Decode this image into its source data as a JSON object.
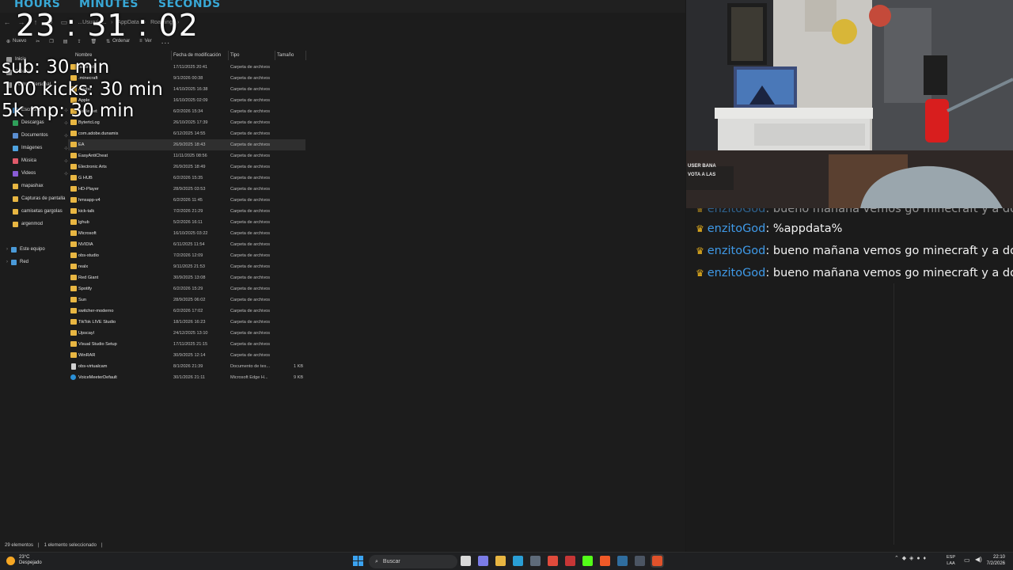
{
  "stream_timer": {
    "labels": [
      "HOURS",
      "MINUTES",
      "SECONDS"
    ],
    "value": "23 :  31 :  02"
  },
  "goals": [
    "sub: 30 min",
    "100 kicks: 30 min",
    "5k mp: 30 min"
  ],
  "explorer": {
    "breadcrumbs": [
      "...Usuario...",
      "AppData",
      "Roaming"
    ],
    "toolbar": {
      "new_label": "Nuevo",
      "sort_label": "Ordenar",
      "view_label": "Ver",
      "more_label": "..."
    },
    "nav": {
      "top": [
        {
          "label": "Inicio",
          "icon": "home-icon"
        },
        {
          "label": "Galería",
          "icon": "gallery-icon"
        },
        {
          "label": "Pedro - Personal",
          "icon": "cloud-icon"
        }
      ],
      "quick": [
        {
          "label": "Escritorio",
          "icon": "desktop-icon",
          "color": "#3d8fd6"
        },
        {
          "label": "Descargas",
          "icon": "download-icon",
          "color": "#2f9f5a"
        },
        {
          "label": "Documentos",
          "icon": "documents-icon",
          "color": "#5b8fd1"
        },
        {
          "label": "Imágenes",
          "icon": "pictures-icon",
          "color": "#4fa3e0"
        },
        {
          "label": "Música",
          "icon": "music-icon",
          "color": "#e05a6a"
        },
        {
          "label": "Videos",
          "icon": "videos-icon",
          "color": "#8a5cd6"
        },
        {
          "label": "mapashax",
          "icon": "folder-icon",
          "color": "#e8b642"
        },
        {
          "label": "Capturas de pantalla",
          "icon": "folder-icon",
          "color": "#e8b642"
        },
        {
          "label": "camisetas gargolas",
          "icon": "folder-icon",
          "color": "#e8b642"
        },
        {
          "label": "argenmod",
          "icon": "folder-icon",
          "color": "#e8b642"
        }
      ],
      "bottom": [
        {
          "label": "Este equipo",
          "icon": "computer-icon",
          "color": "#4a9ad8"
        },
        {
          "label": "Red",
          "icon": "network-icon",
          "color": "#4a9ad8"
        }
      ]
    },
    "columns": {
      "name": "Nombre",
      "date": "Fecha de modificación",
      "type": "Tipo",
      "size": "Tamaño"
    },
    "files": [
      {
        "name": ".android",
        "date": "17/11/2025 20:41",
        "type": "Carpeta de archivos",
        "size": "",
        "kind": "folder"
      },
      {
        "name": ".minecraft",
        "date": "9/1/2026 00:38",
        "type": "Carpeta de archivos",
        "size": "",
        "kind": "folder"
      },
      {
        "name": "Adobe",
        "date": "14/10/2025 16:38",
        "type": "Carpeta de archivos",
        "size": "",
        "kind": "folder"
      },
      {
        "name": "Apple",
        "date": "16/10/2025 02:09",
        "type": "Carpeta de archivos",
        "size": "",
        "kind": "folder"
      },
      {
        "name": "Battle.net",
        "date": "6/2/2026 15:34",
        "type": "Carpeta de archivos",
        "size": "",
        "kind": "folder"
      },
      {
        "name": "BytertcLog",
        "date": "26/10/2025 17:39",
        "type": "Carpeta de archivos",
        "size": "",
        "kind": "folder"
      },
      {
        "name": "com.adobe.dunamis",
        "date": "6/12/2025 14:55",
        "type": "Carpeta de archivos",
        "size": "",
        "kind": "folder"
      },
      {
        "name": "EA",
        "date": "26/9/2025 18:43",
        "type": "Carpeta de archivos",
        "size": "",
        "kind": "folder",
        "selected": true
      },
      {
        "name": "EasyAntiCheat",
        "date": "11/11/2025 08:56",
        "type": "Carpeta de archivos",
        "size": "",
        "kind": "folder"
      },
      {
        "name": "Electronic Arts",
        "date": "26/9/2025 18:49",
        "type": "Carpeta de archivos",
        "size": "",
        "kind": "folder"
      },
      {
        "name": "G HUB",
        "date": "6/2/2026 15:35",
        "type": "Carpeta de archivos",
        "size": "",
        "kind": "folder"
      },
      {
        "name": "HD-Player",
        "date": "28/9/2025 03:53",
        "type": "Carpeta de archivos",
        "size": "",
        "kind": "folder"
      },
      {
        "name": "hmsapp-v4",
        "date": "6/2/2026 11:45",
        "type": "Carpeta de archivos",
        "size": "",
        "kind": "folder"
      },
      {
        "name": "kick-talk",
        "date": "7/2/2026 21:29",
        "type": "Carpeta de archivos",
        "size": "",
        "kind": "folder"
      },
      {
        "name": "lghub",
        "date": "5/2/2026 16:11",
        "type": "Carpeta de archivos",
        "size": "",
        "kind": "folder"
      },
      {
        "name": "Microsoft",
        "date": "16/10/2025 03:22",
        "type": "Carpeta de archivos",
        "size": "",
        "kind": "folder"
      },
      {
        "name": "NVIDIA",
        "date": "6/11/2025 11:54",
        "type": "Carpeta de archivos",
        "size": "",
        "kind": "folder"
      },
      {
        "name": "obs-studio",
        "date": "7/2/2026 12:09",
        "type": "Carpeta de archivos",
        "size": "",
        "kind": "folder"
      },
      {
        "name": "realx",
        "date": "9/11/2025 21:53",
        "type": "Carpeta de archivos",
        "size": "",
        "kind": "folder"
      },
      {
        "name": "Red Giant",
        "date": "30/9/2025 13:08",
        "type": "Carpeta de archivos",
        "size": "",
        "kind": "folder"
      },
      {
        "name": "Spotify",
        "date": "6/2/2026 15:29",
        "type": "Carpeta de archivos",
        "size": "",
        "kind": "folder"
      },
      {
        "name": "Sun",
        "date": "28/9/2025 06:02",
        "type": "Carpeta de archivos",
        "size": "",
        "kind": "folder"
      },
      {
        "name": "switcher-moderno",
        "date": "6/2/2026 17:02",
        "type": "Carpeta de archivos",
        "size": "",
        "kind": "folder"
      },
      {
        "name": "TikTok LIVE Studio",
        "date": "18/1/2026 16:23",
        "type": "Carpeta de archivos",
        "size": "",
        "kind": "folder"
      },
      {
        "name": "Upscayl",
        "date": "24/12/2025 13:10",
        "type": "Carpeta de archivos",
        "size": "",
        "kind": "folder"
      },
      {
        "name": "Visual Studio Setup",
        "date": "17/11/2025 21:15",
        "type": "Carpeta de archivos",
        "size": "",
        "kind": "folder"
      },
      {
        "name": "WinRAR",
        "date": "30/9/2025 12:14",
        "type": "Carpeta de archivos",
        "size": "",
        "kind": "folder"
      },
      {
        "name": "obs-virtualcam",
        "date": "8/1/2026 21:39",
        "type": "Documento de tex...",
        "size": "1 KB",
        "kind": "doc"
      },
      {
        "name": "VoiceMeeterDefault",
        "date": "30/1/2026 21:11",
        "type": "Microsoft Edge H...",
        "size": "9 KB",
        "kind": "edge"
      }
    ],
    "status": {
      "count": "29 elementos",
      "selection": "1 elemento seleccionado"
    }
  },
  "webcam": {
    "overlay_lines": [
      "USER BANA",
      "VOTA A LAS"
    ]
  },
  "chat": {
    "messages": [
      {
        "user": "enzitoGod",
        "text": ": bueno mañana vemos go minecraft y a dormir y"
      },
      {
        "user": "enzitoGod",
        "text": ": %appdata%"
      },
      {
        "user": "enzitoGod",
        "text": ": bueno mañana vemos go minecraft y a dormir"
      },
      {
        "user": "enzitoGod",
        "text": ": bueno mañana vemos go minecraft y a dormir"
      }
    ],
    "user_color": "#3f9ae8",
    "crown_color": "#f2b81e"
  },
  "taskbar": {
    "weather_temp": "23°C",
    "weather_desc": "Despejado",
    "search_label": "Buscar",
    "lang_top": "ESP",
    "lang_bottom": "LAA",
    "time": "22:10",
    "date": "7/2/2026",
    "apps": [
      {
        "icon": "task-view-icon",
        "color": "#d9d9d9"
      },
      {
        "icon": "copilot-icon",
        "color": "#7b7ce6"
      },
      {
        "icon": "file-explorer-icon",
        "color": "#e8b642"
      },
      {
        "icon": "edge-icon",
        "color": "#2a9fd6"
      },
      {
        "icon": "calculator-icon",
        "color": "#5e6b7a"
      },
      {
        "icon": "chrome-icon",
        "color": "#e04b3c"
      },
      {
        "icon": "recorder-icon",
        "color": "#c73636"
      },
      {
        "icon": "kick-icon",
        "color": "#53fc18"
      },
      {
        "icon": "brave-icon",
        "color": "#f05a28"
      },
      {
        "icon": "steam-icon",
        "color": "#2f6d9e"
      },
      {
        "icon": "fe-icon",
        "color": "#4b5563"
      },
      {
        "icon": "obs-icon",
        "color": "#e0522b"
      }
    ]
  }
}
